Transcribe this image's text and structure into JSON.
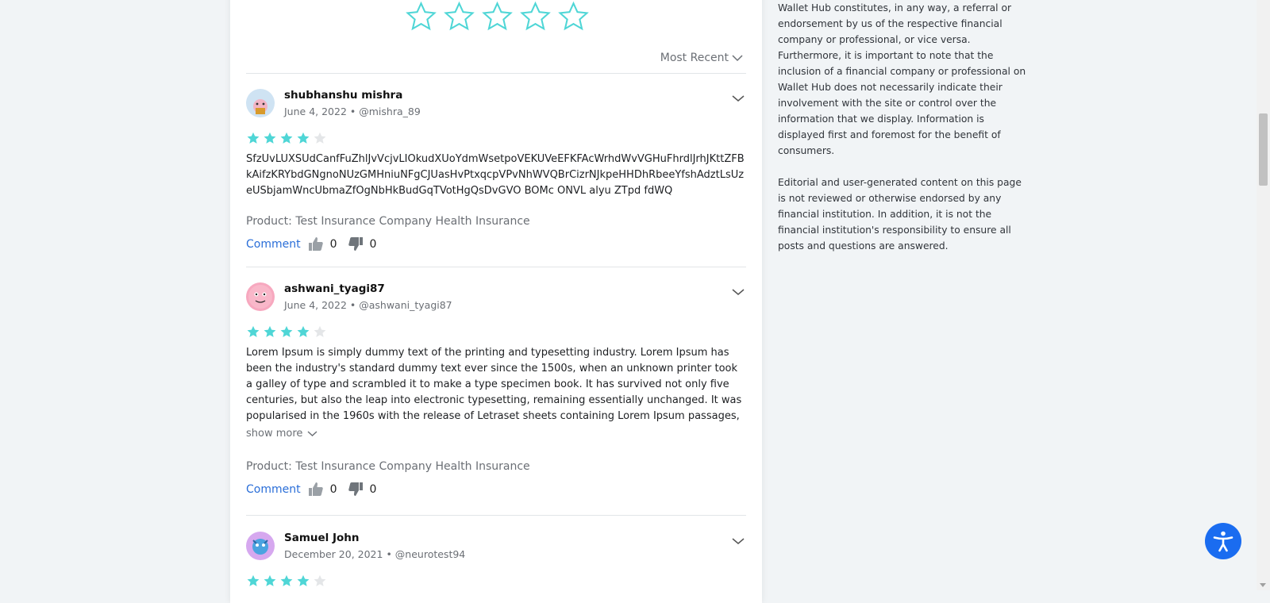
{
  "sort": {
    "label": "Most Recent"
  },
  "reviews": [
    {
      "name": "shubhanshu mishra",
      "date": "June 4, 2022",
      "handle": "@mishra_89",
      "rating": 4,
      "text": "SfzUvLUXSUdCanfFuZhlJvVcjvLIOkudXUoYdmWsetpoVEKUVeEFKFAcWrhdWvVGHuFhrdlJrhJKttZFBkAifzKRYbdGNgnoNUzGMHniuNFgCJUasHvPtxqcpVPvNhWVQBrCizrNJkpeHHDhRbeeYfshAdztLsUzeUSbjamWncUbmaZfOgNbHkBudGqTVotHgQsDvGVO BOMc ONVL alyu ZTpd fdWQ",
      "product": "Product: Test Insurance Company Health Insurance",
      "comment_label": "Comment",
      "likes": "0",
      "dislikes": "0"
    },
    {
      "name": "ashwani_tyagi87",
      "date": "June 4, 2022",
      "handle": "@ashwani_tyagi87",
      "rating": 4,
      "text": "Lorem Ipsum is simply dummy text of the printing and typesetting industry. Lorem Ipsum has been the industry's standard dummy text ever since the 1500s, when an unknown printer took a galley of type and scrambled it to make a type specimen book. It has survived not only five centuries, but also the leap into electronic typesetting, remaining essentially unchanged. It was popularised in the 1960s with the release of Letraset sheets containing Lorem Ipsum passages,",
      "show_more": "show more",
      "product": "Product: Test Insurance Company Health Insurance",
      "comment_label": "Comment",
      "likes": "0",
      "dislikes": "0"
    },
    {
      "name": "Samuel John",
      "date": "December 20, 2021",
      "handle": "@neurotest94",
      "rating": 4
    }
  ],
  "sidebar": {
    "p1": "Wallet Hub constitutes, in any way, a referral or endorsement by us of the respective financial company or professional, or vice versa. Furthermore, it is important to note that the inclusion of a financial company or professional on Wallet Hub does not necessarily indicate their involvement with the site or control over the information that we display. Information is displayed first and foremost for the benefit of consumers.",
    "p2": "Editorial and user-generated content on this page is not reviewed or otherwise endorsed by any financial institution. In addition, it is not the financial institution's responsibility to ensure all posts and questions are answered."
  },
  "colors": {
    "star": "#4fd6d6",
    "star_empty": "#e4e6e8",
    "link": "#2a6ed8",
    "accessibility": "#1a6cf0"
  },
  "icons": [
    "star-outline-icon",
    "star-icon",
    "chevron-down-icon",
    "thumbs-up-icon",
    "thumbs-down-icon",
    "accessibility-icon"
  ]
}
